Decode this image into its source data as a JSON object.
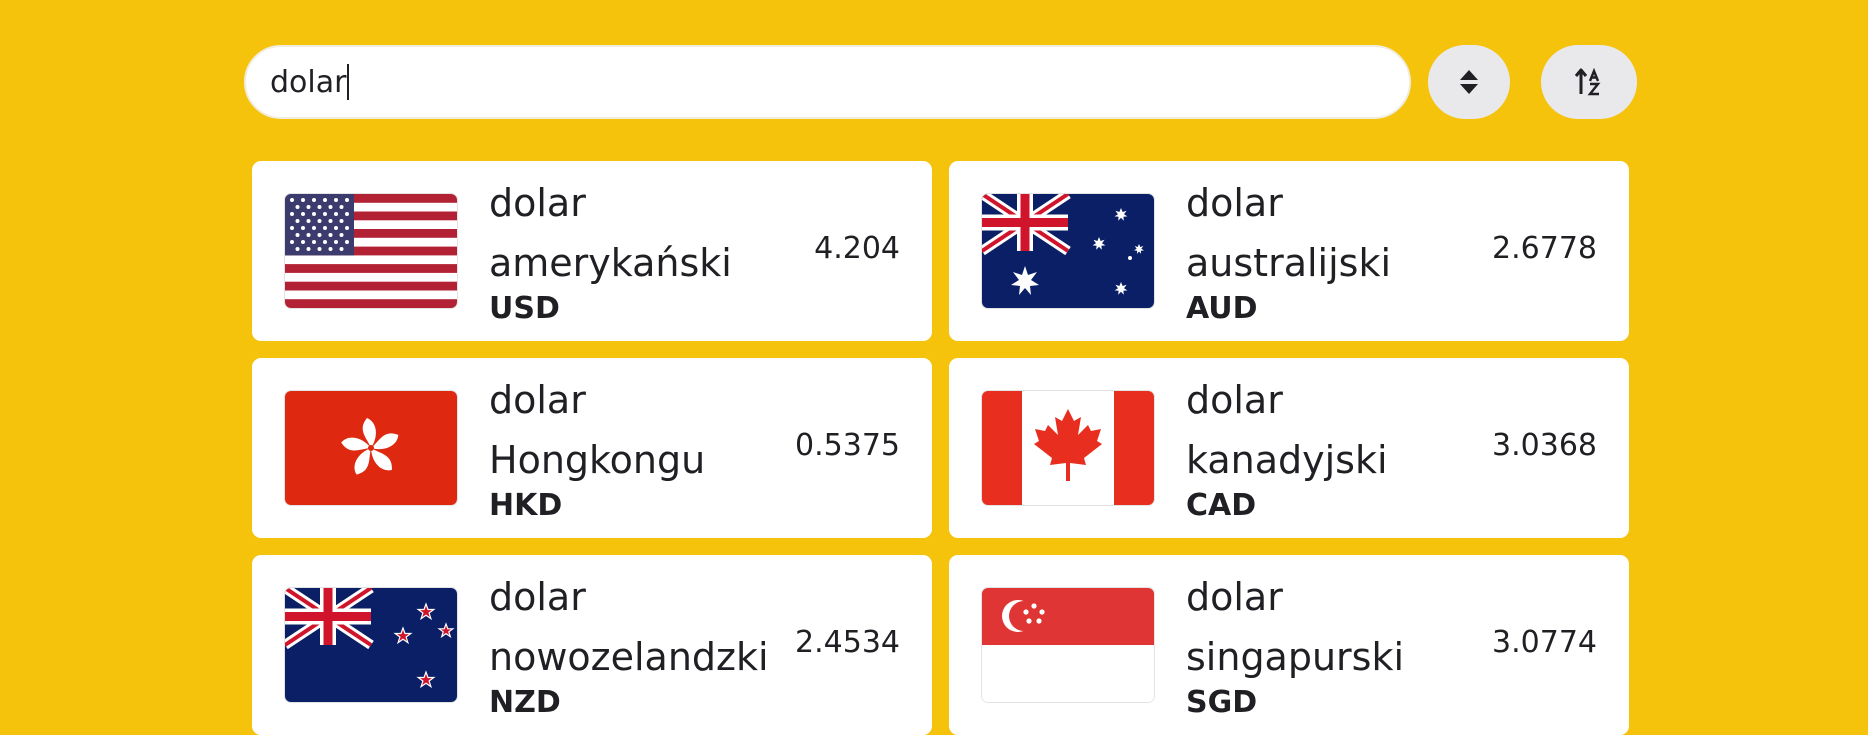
{
  "search": {
    "value": "dolar"
  },
  "buttons": {
    "sort_direction_icon": "sort-up-down-icon",
    "sort_alpha_icon": "sort-alpha-icon"
  },
  "currencies": [
    {
      "name": "dolar amerykański",
      "code": "USD",
      "rate": "4.204",
      "flag_icon": "flag-us-icon"
    },
    {
      "name": "dolar australijski",
      "code": "AUD",
      "rate": "2.6778",
      "flag_icon": "flag-au-icon"
    },
    {
      "name": "dolar Hongkongu",
      "code": "HKD",
      "rate": "0.5375",
      "flag_icon": "flag-hk-icon"
    },
    {
      "name": "dolar kanadyjski",
      "code": "CAD",
      "rate": "3.0368",
      "flag_icon": "flag-ca-icon"
    },
    {
      "name": "dolar nowozelandzki",
      "code": "NZD",
      "rate": "2.4534",
      "flag_icon": "flag-nz-icon"
    },
    {
      "name": "dolar singapurski",
      "code": "SGD",
      "rate": "3.0774",
      "flag_icon": "flag-sg-icon"
    }
  ],
  "colors": {
    "background": "#f5c20c",
    "card": "#ffffff",
    "button": "#e9e9ec"
  }
}
